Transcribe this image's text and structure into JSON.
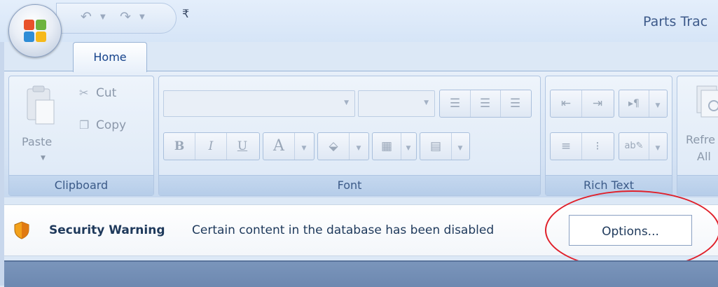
{
  "window": {
    "title": "Parts Trac"
  },
  "tabs": [
    {
      "label": "Home"
    }
  ],
  "clipboard": {
    "paste_label": "Paste",
    "cut_label": "Cut",
    "copy_label": "Copy",
    "group_label": "Clipboard"
  },
  "font": {
    "group_label": "Font",
    "font_name_value": "",
    "font_size_value": "",
    "bold_glyph": "B",
    "italic_glyph": "I",
    "underline_glyph": "U",
    "font_color_glyph": "A"
  },
  "rich_text": {
    "group_label": "Rich Text"
  },
  "records": {
    "refresh_label_line1": "Refre",
    "refresh_label_line2": "All"
  },
  "message_bar": {
    "title": "Security Warning",
    "message": "Certain content in the database has been disabled",
    "options_label": "Options..."
  },
  "colors": {
    "ribbon_bg": "#dce8f6",
    "text_blue": "#15428b",
    "highlight_red": "#e0202a"
  }
}
